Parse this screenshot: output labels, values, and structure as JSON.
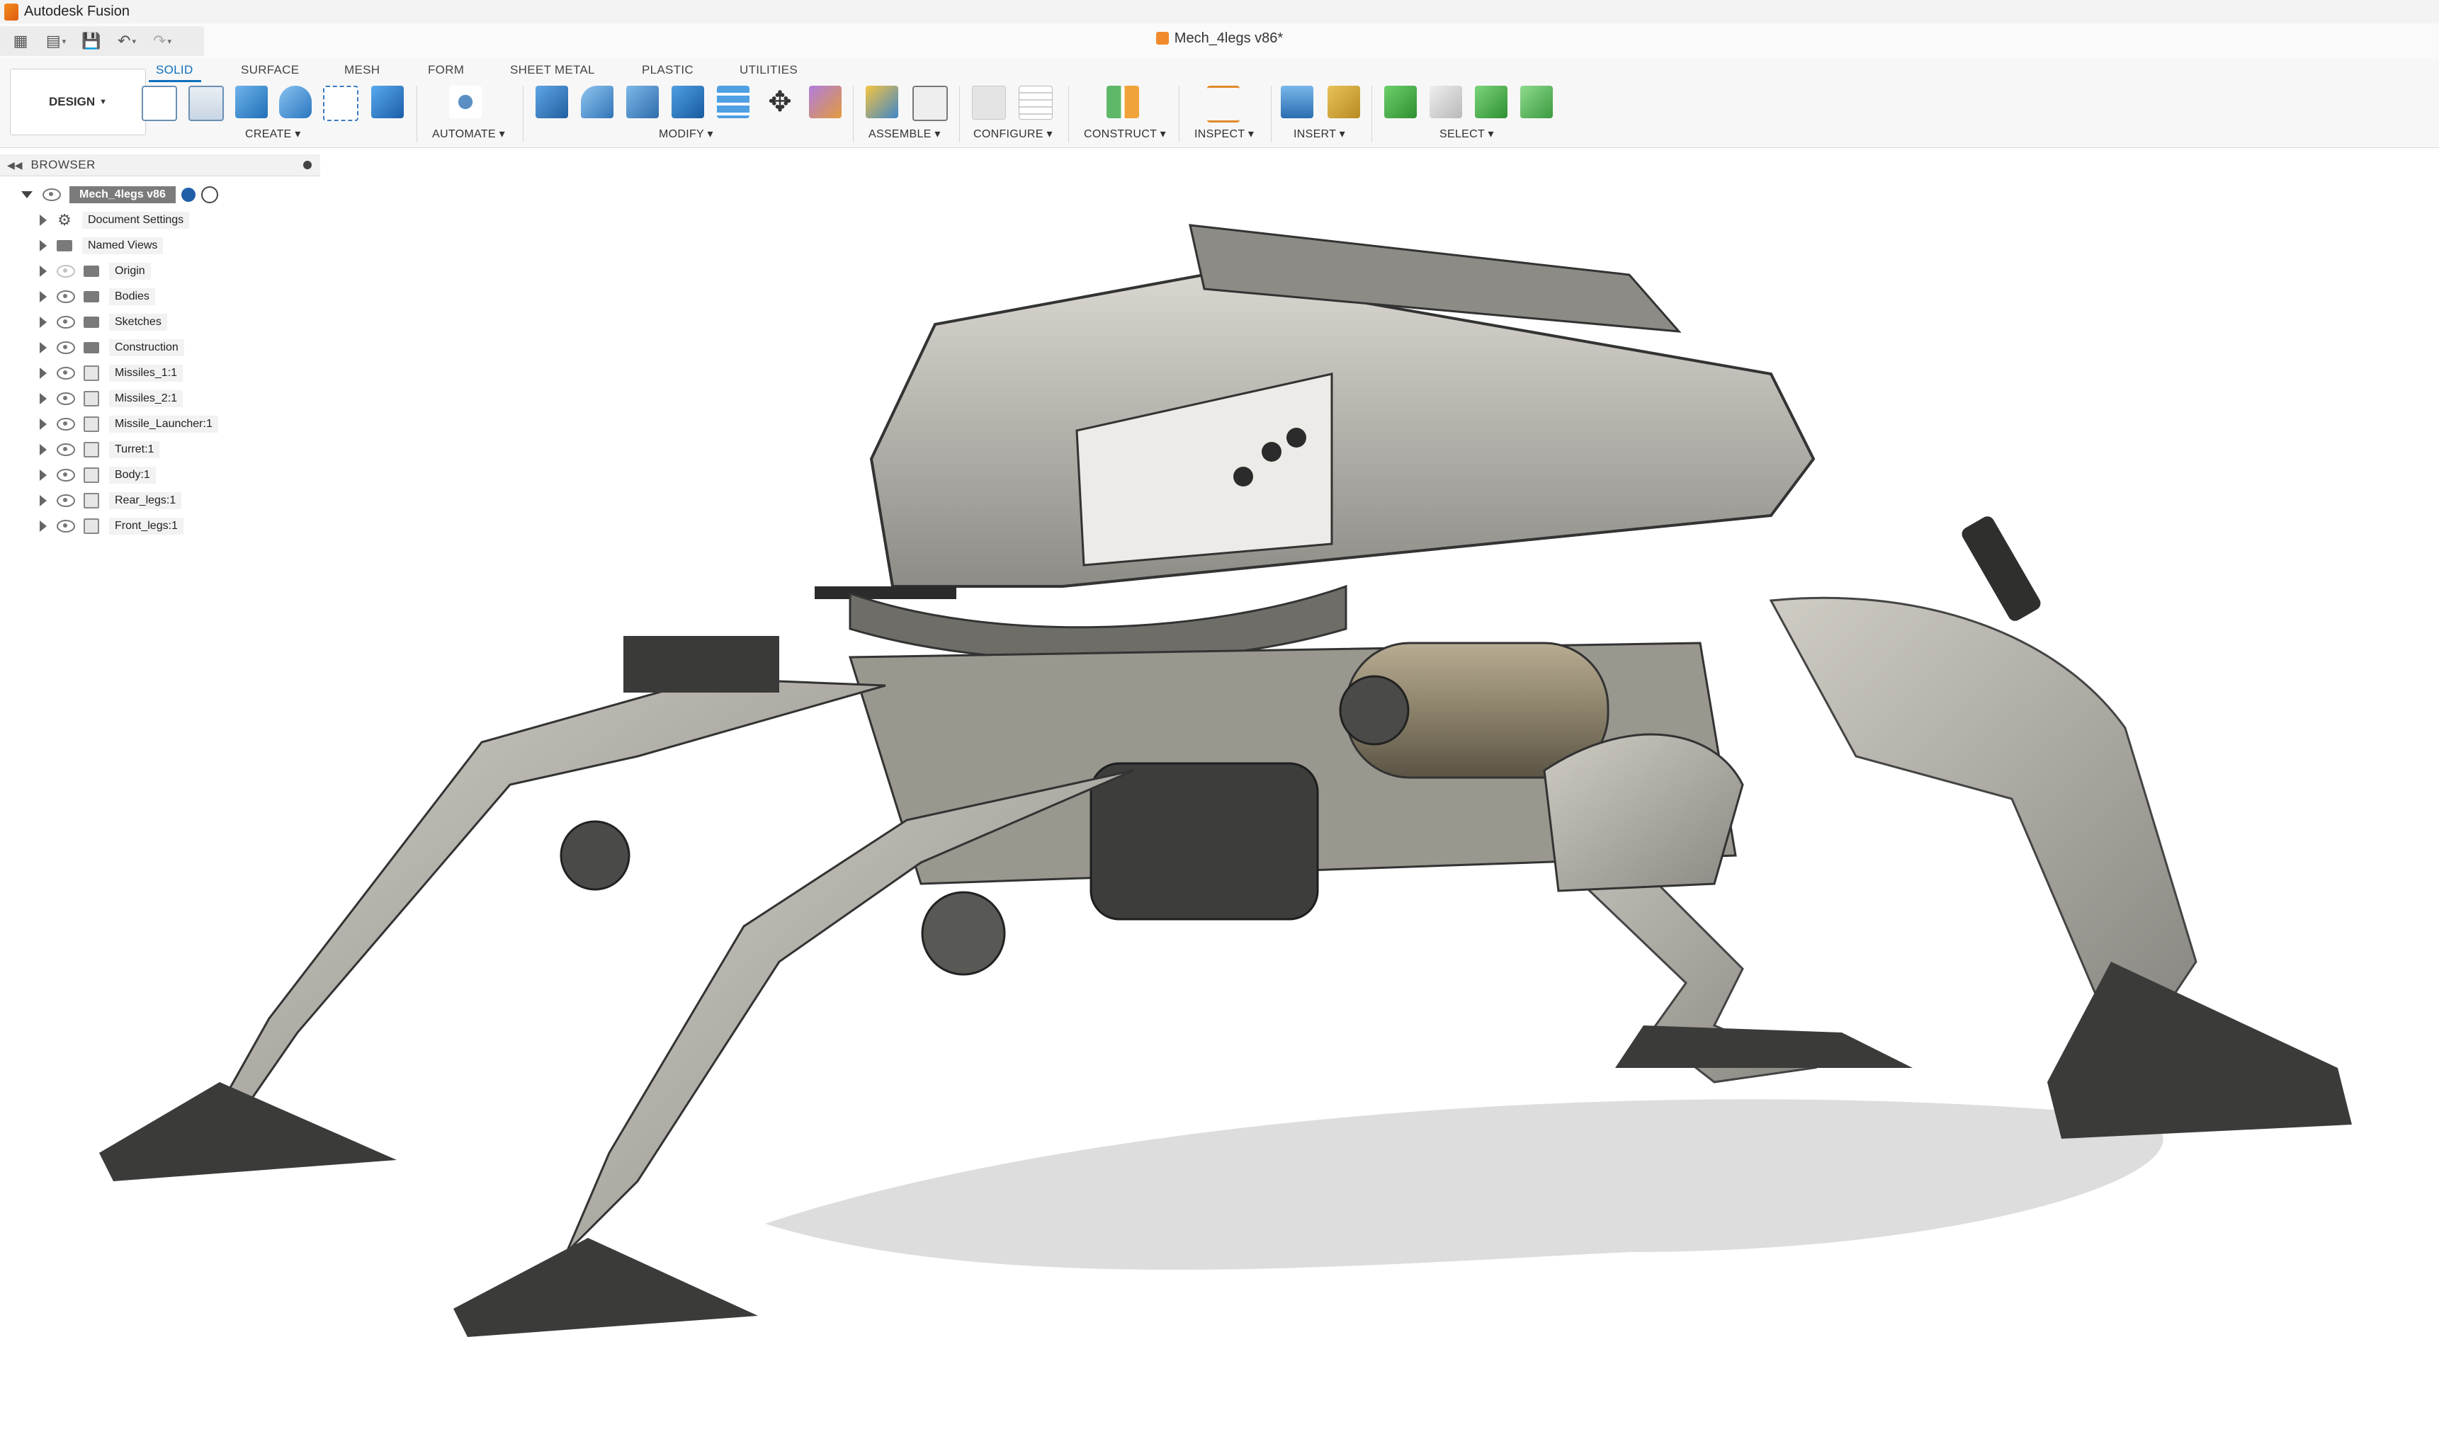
{
  "window": {
    "title": "Autodesk Fusion"
  },
  "document": {
    "title": "Mech_4legs v86*"
  },
  "workspace": {
    "label": "DESIGN"
  },
  "tabs": [
    {
      "label": "SOLID",
      "active": true
    },
    {
      "label": "SURFACE"
    },
    {
      "label": "MESH"
    },
    {
      "label": "FORM"
    },
    {
      "label": "SHEET METAL"
    },
    {
      "label": "PLASTIC"
    },
    {
      "label": "UTILITIES"
    }
  ],
  "groups": {
    "create": "CREATE",
    "automate": "AUTOMATE",
    "modify": "MODIFY",
    "assemble": "ASSEMBLE",
    "configure": "CONFIGURE",
    "construct": "CONSTRUCT",
    "inspect": "INSPECT",
    "insert": "INSERT",
    "select": "SELECT"
  },
  "browser": {
    "header": "BROWSER",
    "root": "Mech_4legs v86",
    "items": [
      {
        "label": "Document Settings",
        "icon": "gear-icon"
      },
      {
        "label": "Named Views",
        "icon": "folder-icon"
      },
      {
        "label": "Origin",
        "icon": "folder-icon"
      },
      {
        "label": "Bodies",
        "icon": "folder-icon"
      },
      {
        "label": "Sketches",
        "icon": "folder-icon"
      },
      {
        "label": "Construction",
        "icon": "folder-icon"
      },
      {
        "label": "Missiles_1:1",
        "icon": "component-icon"
      },
      {
        "label": "Missiles_2:1",
        "icon": "component-icon"
      },
      {
        "label": "Missile_Launcher:1",
        "icon": "component-icon"
      },
      {
        "label": "Turret:1",
        "icon": "component-icon"
      },
      {
        "label": "Body:1",
        "icon": "component-icon"
      },
      {
        "label": "Rear_legs:1",
        "icon": "component-icon"
      },
      {
        "label": "Front_legs:1",
        "icon": "component-icon"
      }
    ]
  },
  "colors": {
    "accent": "#0e6fbd",
    "model_light": "#bdbab3",
    "model_mid": "#8f8d87",
    "model_dark": "#3b3b39",
    "shadow": "#d9d9d9"
  }
}
